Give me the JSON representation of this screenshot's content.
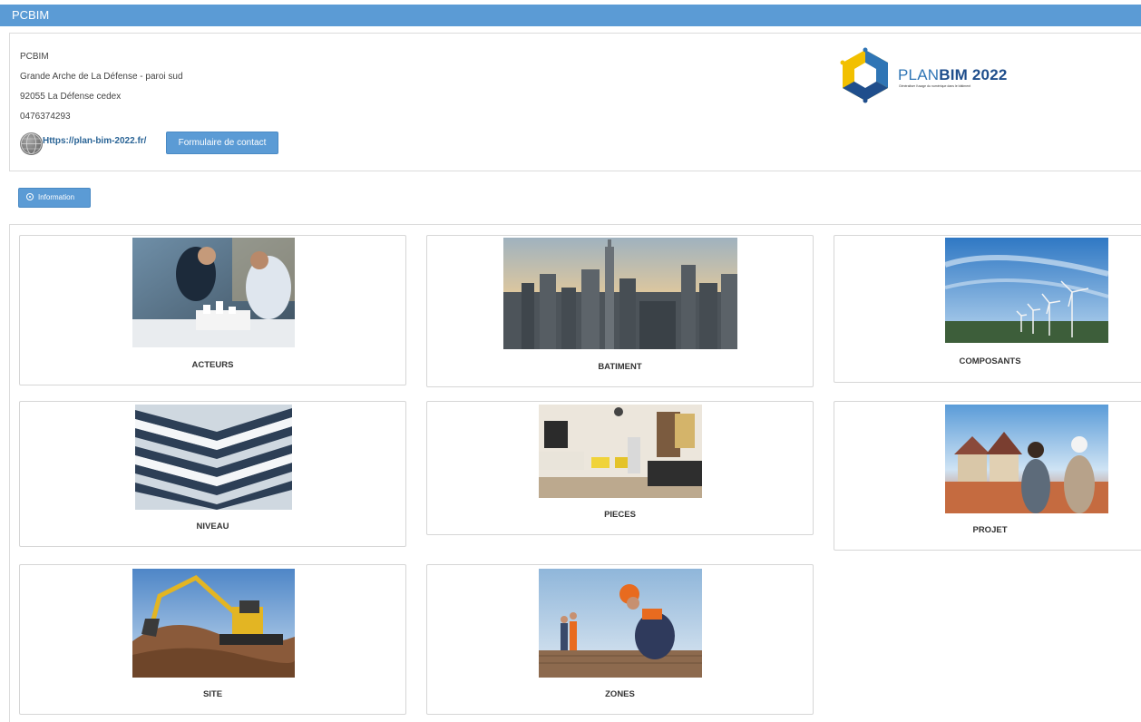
{
  "window": {
    "title": "PCBIM"
  },
  "organization": {
    "name": "PCBIM",
    "address_line1": "Grande Arche de La Défense - paroi sud",
    "address_line2": "92055 La Défense cedex",
    "phone": "0476374293",
    "website": "Https://plan-bim-2022.fr/",
    "contact_button": "Formulaire de contact"
  },
  "logo": {
    "plan": "PLAN",
    "bim": "BIM 2022",
    "tagline": "Généraliser l'usage du numérique dans le bâtiment",
    "colors": {
      "yellow": "#f2c000",
      "blue": "#2f75b5",
      "dark_blue": "#1f4e8c"
    }
  },
  "info_button": {
    "label": "Information",
    "icon": "info-circle-icon"
  },
  "cards": [
    {
      "label": "ACTEURS",
      "image": "people-around-building-model"
    },
    {
      "label": "BATIMENT",
      "image": "city-skyline"
    },
    {
      "label": "COMPOSANTS",
      "image": "wind-turbines"
    },
    {
      "label": "NIVEAU",
      "image": "office-building-facade"
    },
    {
      "label": "PIECES",
      "image": "living-room-interior"
    },
    {
      "label": "PROJET",
      "image": "couple-looking-at-houses"
    },
    {
      "label": "SITE",
      "image": "excavator-on-dirt"
    },
    {
      "label": "ZONES",
      "image": "workers-in-field"
    }
  ],
  "colors": {
    "accent": "#5b9bd5",
    "link": "#2a6496",
    "border": "#d6d6d6"
  }
}
